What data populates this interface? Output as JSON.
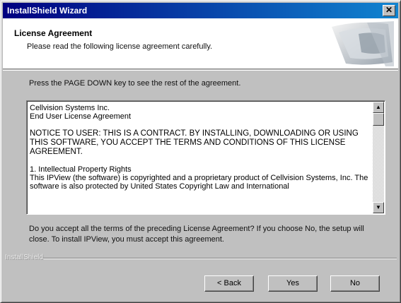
{
  "window": {
    "title": "InstallShield Wizard",
    "close_glyph": "✕"
  },
  "header": {
    "title": "License Agreement",
    "subtitle": "Please read the following license agreement carefully."
  },
  "instruction": "Press the PAGE DOWN key to see the rest of the agreement.",
  "license": {
    "company": "Cellvision Systems Inc.",
    "eula": "End User License Agreement",
    "notice": "NOTICE TO USER: THIS IS A CONTRACT. BY INSTALLING, DOWNLOADING OR USING THIS SOFTWARE, YOU ACCEPT THE TERMS AND CONDITIONS OF THIS LICENSE AGREEMENT.",
    "section_title": "1. Intellectual Property Rights",
    "section_body": "This IPView (the software) is copyrighted and a proprietary product of Cellvision Systems, Inc. The software is also protected by United States Copyright Law and International"
  },
  "question": "Do you accept all the terms of the preceding License Agreement? If you choose No, the setup will close. To install IPView, you must accept this agreement.",
  "brand": "InstallShield",
  "buttons": {
    "back": "< Back",
    "yes": "Yes",
    "no": "No"
  },
  "icons": {
    "scroll_up": "▲",
    "scroll_down": "▼"
  },
  "colors": {
    "titlebar_start": "#000080",
    "titlebar_end": "#1084d0",
    "dialog_face": "#c0c0c0"
  }
}
